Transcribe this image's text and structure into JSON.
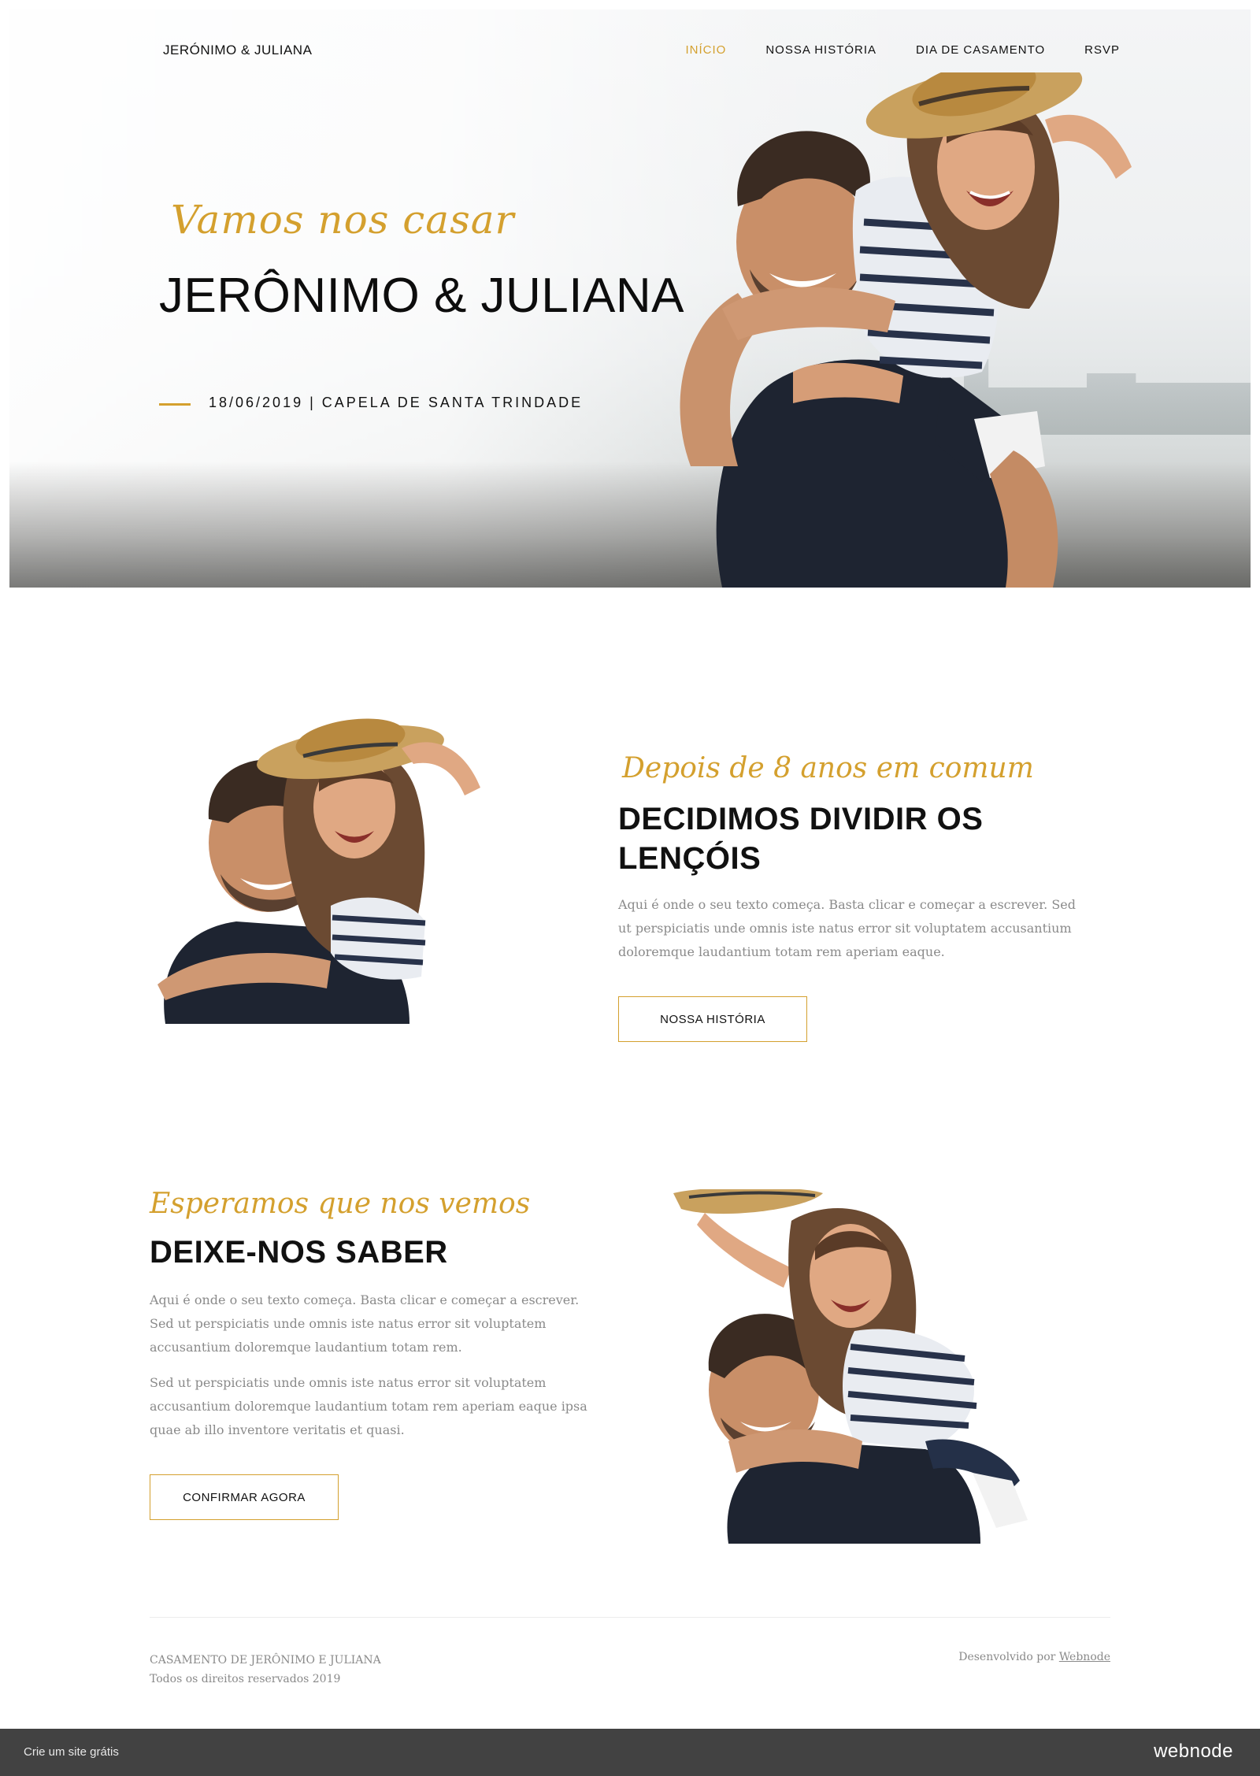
{
  "colors": {
    "accent": "#d4a02e",
    "text": "#111111",
    "muted": "#8a8a8a",
    "bar": "#424242"
  },
  "nav": {
    "brand": "JERÓNIMO & JULIANA",
    "items": [
      {
        "label": "INÍCIO",
        "active": true
      },
      {
        "label": "NOSSA HISTÓRIA",
        "active": false
      },
      {
        "label": "DIA DE CASAMENTO",
        "active": false
      },
      {
        "label": "RSVP",
        "active": false
      }
    ]
  },
  "hero": {
    "script": "Vamos nos casar",
    "title": "JERÔNIMO & JULIANA",
    "date_place": "18/06/2019 | CAPELA DE SANTA TRINDADE",
    "photo": "couple-piggyback-photo"
  },
  "story": {
    "script": "Depois de 8 anos em comum",
    "title": "DECIDIMOS DIVIDIR OS LENÇÓIS",
    "text": "Aqui é onde o seu texto começa. Basta clicar e começar a escrever. Sed ut perspiciatis unde omnis iste natus error sit voluptatem accusantium doloremque laudantium totam rem aperiam eaque.",
    "button": "NOSSA HISTÓRIA",
    "photo": "couple-laughing-photo"
  },
  "rsvp": {
    "script": "Esperamos que nos vemos",
    "title": "DEIXE-NOS SABER",
    "text1": "Aqui é onde o seu texto começa. Basta clicar e começar a escrever. Sed ut perspiciatis unde omnis iste natus error sit voluptatem accusantium doloremque laudantium totam rem.",
    "text2": "Sed ut perspiciatis unde omnis iste natus error sit voluptatem accusantium doloremque laudantium totam rem aperiam eaque ipsa quae ab illo inventore veritatis et quasi.",
    "button": "CONFIRMAR AGORA",
    "photo": "couple-piggyback-cutout-photo"
  },
  "footer": {
    "line1": "CASAMENTO DE JERÔNIMO E JULIANA",
    "line2": "Todos os direitos reservados 2019",
    "developed_by": "Desenvolvido por",
    "developer": "Webnode"
  },
  "webnode_bar": {
    "left": "Crie um site grátis",
    "right": "webnode"
  }
}
